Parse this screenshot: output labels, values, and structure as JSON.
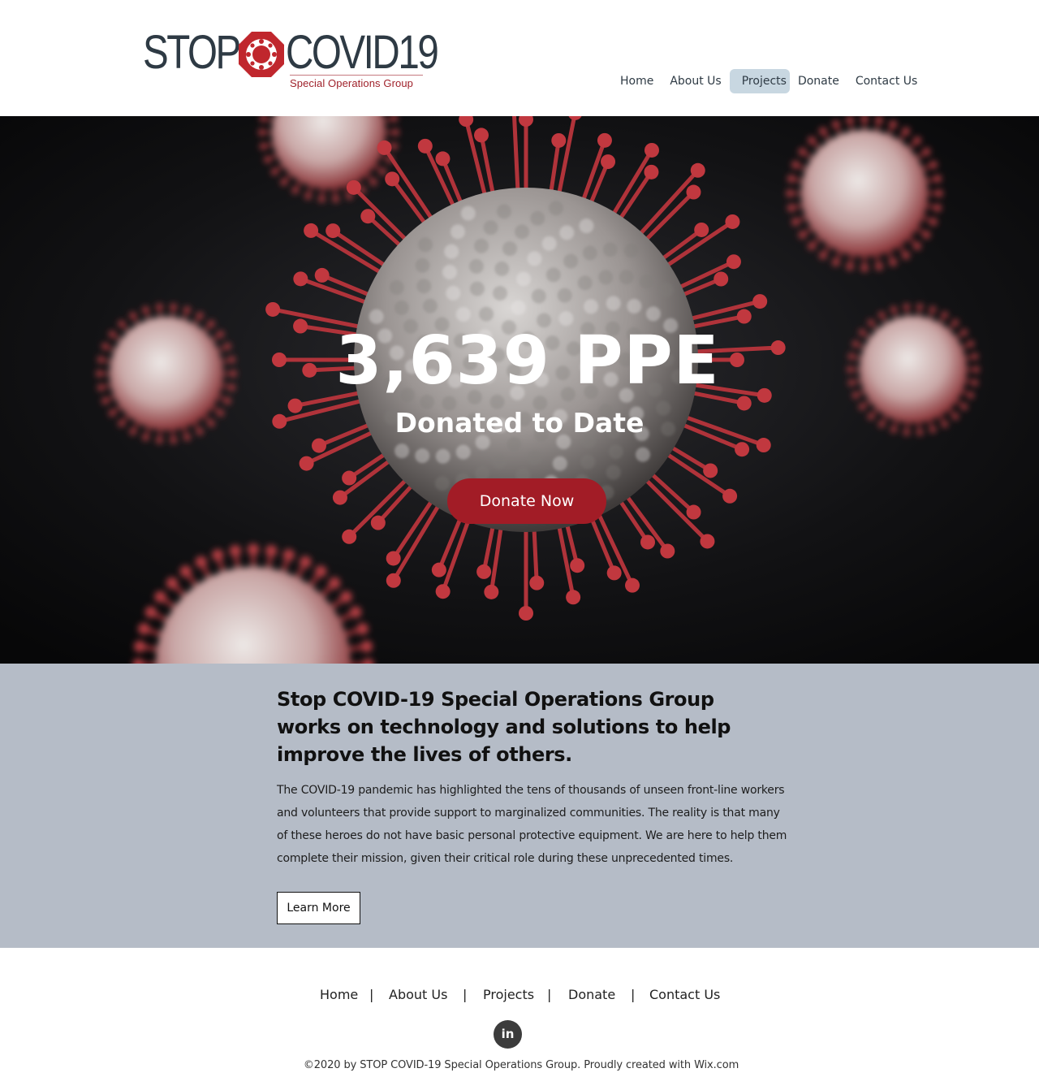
{
  "header": {
    "logo": {
      "word_stop": "STOP",
      "word_covid": "COVID19",
      "tagline": "Special Operations Group"
    },
    "nav": [
      {
        "label": "Home"
      },
      {
        "label": "About Us"
      },
      {
        "label": "Projects",
        "active": true
      },
      {
        "label": "Donate"
      },
      {
        "label": "Contact Us"
      }
    ]
  },
  "hero": {
    "count": "3,639 PPE",
    "subtitle": "Donated to Date",
    "donate_button": "Donate Now",
    "button_color": "#a21c26"
  },
  "about": {
    "title": "Stop COVID-19 Special Operations Group works on technology and solutions to help improve the lives of others.",
    "body": "The COVID-19 pandemic has highlighted the tens of thousands of unseen front-line workers and volunteers that provide support to marginalized communities. The reality is that many of these heroes do not have basic personal protective equipment. We are here to help them complete their mission, given their critical role during these unprecedented times.",
    "learn_more": "Learn More",
    "background": "#b5bcc7"
  },
  "footer": {
    "nav": [
      {
        "label": "Home"
      },
      {
        "label": "About Us"
      },
      {
        "label": "Projects"
      },
      {
        "label": "Donate"
      },
      {
        "label": "Contact Us"
      }
    ],
    "separator": "|",
    "social": {
      "icon": "linkedin-icon",
      "glyph": "in"
    },
    "copyright": "©2020 by STOP COVID-19 Special Operations Group. Proudly created with Wix.com"
  },
  "colors": {
    "brand_dark": "#2e3a44",
    "brand_red": "#a0222b",
    "nav_active": "#c8d7e1"
  }
}
